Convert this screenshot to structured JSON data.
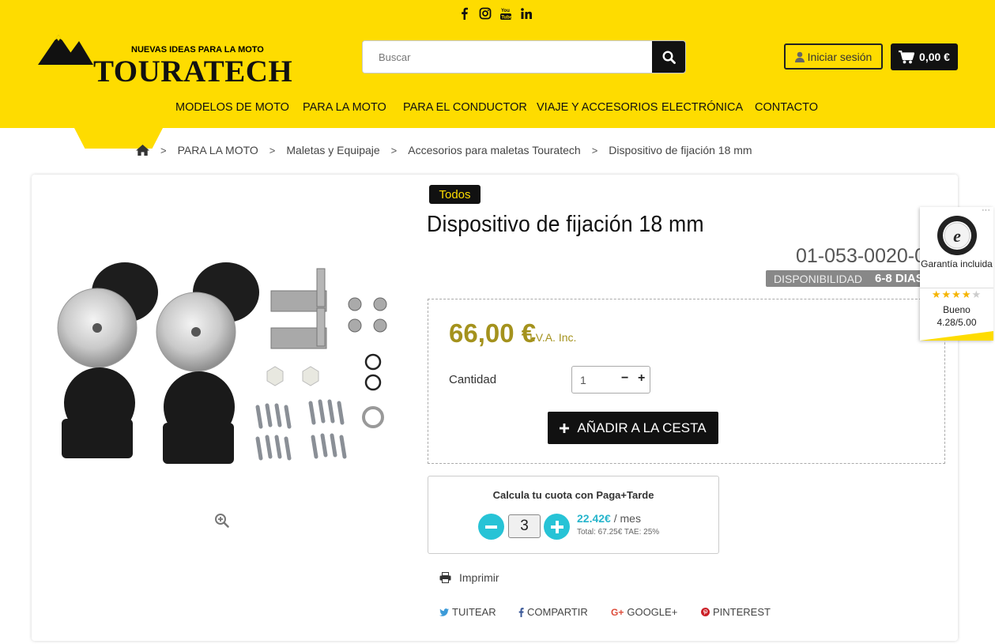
{
  "header": {
    "logo_tagline": "NUEVAS IDEAS PARA LA MOTO",
    "logo_name": "TOURATECH",
    "search_placeholder": "Buscar",
    "login_label": "Iniciar sesión",
    "cart_total": "0,00 €",
    "social": [
      "facebook-icon",
      "instagram-icon",
      "youtube-icon",
      "linkedin-icon"
    ],
    "accent_color": "#fedc00"
  },
  "nav": {
    "items": [
      "MODELOS DE MOTO",
      "PARA LA MOTO",
      "PARA EL CONDUCTOR",
      "VIAJE Y ACCESORIOS",
      "ELECTRÓNICA",
      "CONTACTO"
    ]
  },
  "breadcrumb": {
    "items": [
      "PARA LA MOTO",
      "Maletas y Equipaje",
      "Accesorios para maletas Touratech",
      "Dispositivo de fijación 18 mm"
    ]
  },
  "product": {
    "badge": "Todos",
    "title": "Dispositivo de fijación 18 mm",
    "reference": "01-053-0020-0",
    "availability_label": "DISPONIBILIDAD",
    "availability_value": "6-8 DIAS",
    "price": "66,00 €",
    "tax_label": "I.V.A. Inc.",
    "quantity_label": "Cantidad",
    "quantity_value": "1",
    "add_to_cart": "AÑADIR A LA CESTA"
  },
  "financing": {
    "title": "Calcula tu cuota con Paga+Tarde",
    "months": "3",
    "monthly": "22.42€",
    "per_month": "/ mes",
    "total_line": "Total: 67.25€ TAE: 25%",
    "accent_color": "#27c3d6"
  },
  "actions": {
    "print": "Imprimir",
    "tweet": "TUITEAR",
    "share": "COMPARTIR",
    "google": "GOOGLE+",
    "pinterest": "PINTEREST"
  },
  "trusted_shops": {
    "guarantee": "Garantía incluida",
    "rating_word": "Bueno",
    "rating": "4.28/5.00",
    "stars": 4.28
  }
}
